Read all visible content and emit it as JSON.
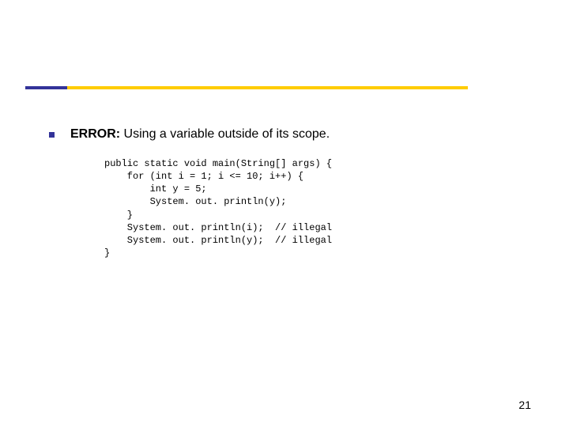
{
  "bullet": {
    "bold": "ERROR:",
    "rest": " Using a variable outside of its scope."
  },
  "code": "public static void main(String[] args) {\n    for (int i = 1; i <= 10; i++) {\n        int y = 5;\n        System. out. println(y);\n    }\n    System. out. println(i);  // illegal\n    System. out. println(y);  // illegal\n}",
  "pageNumber": "21"
}
